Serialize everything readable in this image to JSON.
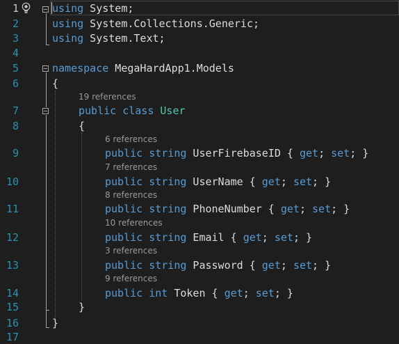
{
  "editor": {
    "lines": [
      {
        "num": "1",
        "tokens": [
          [
            "kw",
            "using"
          ],
          [
            "plain",
            " System;"
          ]
        ]
      },
      {
        "num": "2",
        "tokens": [
          [
            "kw",
            "using"
          ],
          [
            "plain",
            " System.Collections.Generic;"
          ]
        ]
      },
      {
        "num": "3",
        "tokens": [
          [
            "kw",
            "using"
          ],
          [
            "plain",
            " System.Text;"
          ]
        ]
      },
      {
        "num": "4",
        "tokens": []
      },
      {
        "num": "5",
        "tokens": [
          [
            "kw",
            "namespace"
          ],
          [
            "plain",
            " MegaHardApp1.Models"
          ]
        ]
      },
      {
        "num": "6",
        "tokens": [
          [
            "plain",
            "{"
          ]
        ]
      },
      {
        "num": "7",
        "tokens": [
          [
            "kw",
            "public"
          ],
          [
            "plain",
            " "
          ],
          [
            "kw",
            "class"
          ],
          [
            "plain",
            " "
          ],
          [
            "cls",
            "User"
          ]
        ]
      },
      {
        "num": "8",
        "tokens": [
          [
            "plain",
            "{"
          ]
        ]
      },
      {
        "num": "9",
        "tokens": [
          [
            "kw",
            "public"
          ],
          [
            "plain",
            " "
          ],
          [
            "kw",
            "string"
          ],
          [
            "plain",
            " UserFirebaseID { "
          ],
          [
            "kw",
            "get"
          ],
          [
            "plain",
            "; "
          ],
          [
            "kw",
            "set"
          ],
          [
            "plain",
            "; }"
          ]
        ]
      },
      {
        "num": "10",
        "tokens": [
          [
            "kw",
            "public"
          ],
          [
            "plain",
            " "
          ],
          [
            "kw",
            "string"
          ],
          [
            "plain",
            " UserName { "
          ],
          [
            "kw",
            "get"
          ],
          [
            "plain",
            "; "
          ],
          [
            "kw",
            "set"
          ],
          [
            "plain",
            "; }"
          ]
        ]
      },
      {
        "num": "11",
        "tokens": [
          [
            "kw",
            "public"
          ],
          [
            "plain",
            " "
          ],
          [
            "kw",
            "string"
          ],
          [
            "plain",
            " PhoneNumber { "
          ],
          [
            "kw",
            "get"
          ],
          [
            "plain",
            "; "
          ],
          [
            "kw",
            "set"
          ],
          [
            "plain",
            "; }"
          ]
        ]
      },
      {
        "num": "12",
        "tokens": [
          [
            "kw",
            "public"
          ],
          [
            "plain",
            " "
          ],
          [
            "kw",
            "string"
          ],
          [
            "plain",
            " Email { "
          ],
          [
            "kw",
            "get"
          ],
          [
            "plain",
            "; "
          ],
          [
            "kw",
            "set"
          ],
          [
            "plain",
            "; }"
          ]
        ]
      },
      {
        "num": "13",
        "tokens": [
          [
            "kw",
            "public"
          ],
          [
            "plain",
            " "
          ],
          [
            "kw",
            "string"
          ],
          [
            "plain",
            " Password { "
          ],
          [
            "kw",
            "get"
          ],
          [
            "plain",
            "; "
          ],
          [
            "kw",
            "set"
          ],
          [
            "plain",
            "; }"
          ]
        ]
      },
      {
        "num": "14",
        "tokens": [
          [
            "kw",
            "public"
          ],
          [
            "plain",
            " "
          ],
          [
            "kw",
            "int"
          ],
          [
            "plain",
            " Token { "
          ],
          [
            "kw",
            "get"
          ],
          [
            "plain",
            "; "
          ],
          [
            "kw",
            "set"
          ],
          [
            "plain",
            "; }"
          ]
        ]
      },
      {
        "num": "15",
        "tokens": [
          [
            "plain",
            "}"
          ]
        ]
      },
      {
        "num": "16",
        "tokens": [
          [
            "plain",
            "}"
          ]
        ]
      },
      {
        "num": "17",
        "tokens": []
      }
    ],
    "codelens": {
      "class_user": "19 references",
      "user_firebase_id": "6 references",
      "user_name": "7 references",
      "phone_number": "8 references",
      "email": "10 references",
      "password": "3 references",
      "token": "9 references"
    },
    "current_line": "1",
    "icons": {
      "lightbulb": "lightbulb-icon",
      "fold": "collapse-icon"
    },
    "colors": {
      "background": "#1e1e1e",
      "keyword": "#569cd6",
      "type": "#4ec9b0",
      "text": "#dcdcdc",
      "line_number": "#2b91af",
      "codelens": "#999999"
    }
  }
}
